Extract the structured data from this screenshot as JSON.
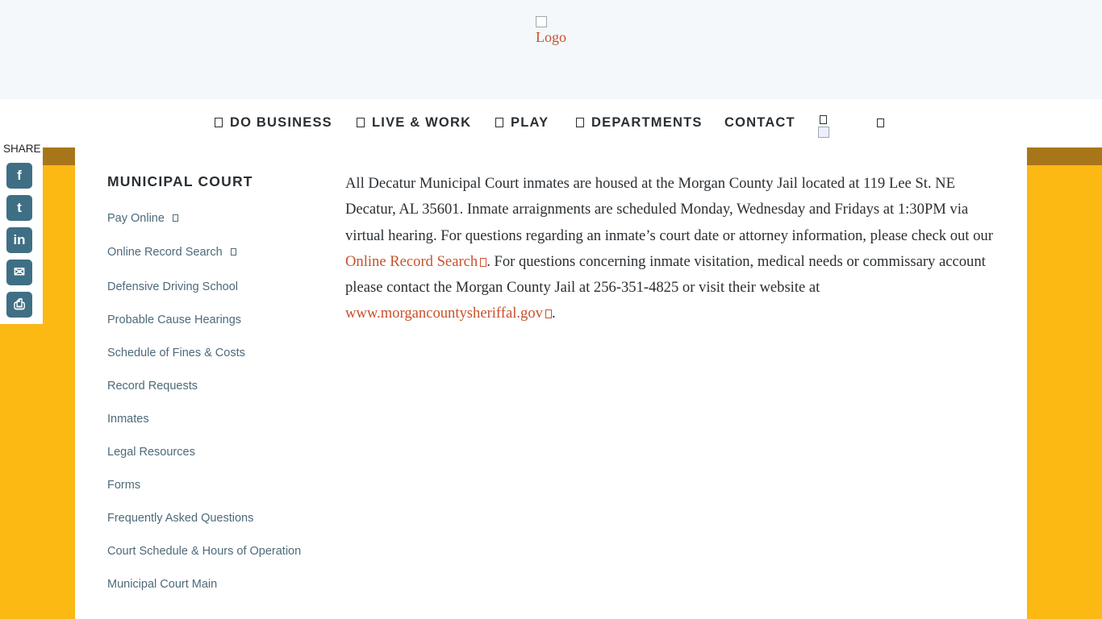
{
  "header": {
    "logo_alt": "Logo"
  },
  "nav": {
    "items": [
      {
        "label": "DO BUSINESS",
        "icon": "box-glyph-icon"
      },
      {
        "label": "LIVE & WORK",
        "icon": "box-glyph-icon"
      },
      {
        "label": "PLAY",
        "icon": "box-glyph-icon"
      },
      {
        "label": "DEPARTMENTS",
        "icon": "box-glyph-icon"
      },
      {
        "label": "CONTACT"
      }
    ]
  },
  "share": {
    "label": "SHARE",
    "buttons": [
      {
        "name": "facebook-icon",
        "glyph": "f"
      },
      {
        "name": "twitter-icon",
        "glyph": "t"
      },
      {
        "name": "linkedin-icon",
        "glyph": "in"
      },
      {
        "name": "email-icon",
        "glyph": "✉"
      },
      {
        "name": "print-icon",
        "glyph": "⎙"
      }
    ],
    "color": "#3f6f84"
  },
  "sidebar": {
    "title": "MUNICIPAL COURT",
    "links": [
      {
        "label": "Pay Online",
        "external": true
      },
      {
        "label": "Online Record Search",
        "external": true
      },
      {
        "label": "Defensive Driving School"
      },
      {
        "label": "Probable Cause Hearings"
      },
      {
        "label": "Schedule of Fines & Costs"
      },
      {
        "label": "Record Requests"
      },
      {
        "label": "Inmates"
      },
      {
        "label": "Legal Resources"
      },
      {
        "label": "Forms"
      },
      {
        "label": "Frequently Asked Questions"
      },
      {
        "label": "Court Schedule & Hours of Operation"
      },
      {
        "label": "Municipal Court Main"
      }
    ]
  },
  "main": {
    "text_1": "All Decatur Municipal Court inmates are housed at the Morgan County Jail located at 119 Lee St. NE Decatur, AL 35601. Inmate arraignments are scheduled Monday, Wednesday and Fridays at 1:30PM via virtual hearing.  For questions regarding an inmate’s court date or attorney information, please check out our ",
    "link_1": "Online Record Search",
    "text_2": ". For questions concerning inmate visitation, medical needs or commissary account please contact the Morgan County Jail at 256-351-4825 or visit their website at ",
    "link_2": "www.morgancountysheriffal.gov",
    "text_3": "."
  },
  "colors": {
    "accent": "#c8512b",
    "band": "#fcb813",
    "band_shade": "#a8761a",
    "link": "#4d6a7a"
  }
}
